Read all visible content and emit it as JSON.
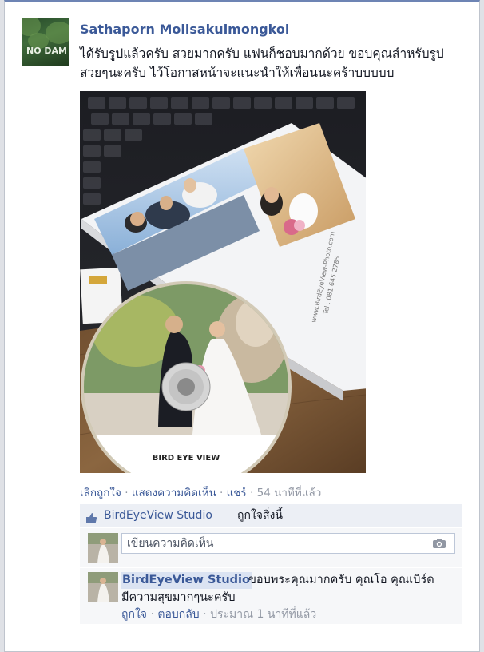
{
  "post": {
    "author": "Sathaporn Molisakulmongkol",
    "avatar_text": "NO DAM",
    "text": "ได้รับรูปแล้วครับ สวยมากครับ แฟนก็ชอบมากด้วย ขอบคุณสำหรับรูปสวยๆนะครับ ไว้โอกาสหน้าจะแนะนำให้เพื่อนนะคร้าบบบบบ",
    "photo": {
      "album_contact": "www.BirdEyeView-Photo.com",
      "album_phone": "Tel : 081 645 2785",
      "disc_brand": "BIRD EYE VIEW"
    }
  },
  "actions": {
    "unlike": "เลิกถูกใจ",
    "comment": "แสดงความคิดเห็น",
    "share": "แชร์",
    "separator": "·",
    "time": "54 นาทีที่แล้ว"
  },
  "likes": {
    "icon": "thumbs-up-icon",
    "who": "BirdEyeView Studio",
    "rest": "ถูกใจสิ่งนี้"
  },
  "comment_box": {
    "placeholder": "เขียนความคิดเห็น",
    "icon": "camera-icon"
  },
  "reply": {
    "author": "BirdEyeView Studio",
    "text_line1": "ขอบพระคุณมากครับ คุณโอ คุณเบิร์ด",
    "text_line2": "มีความสุขมากๆนะครับ",
    "like": "ถูกใจ",
    "reply": "ตอบกลับ",
    "separator": "·",
    "time": "ประมาณ 1 นาทีที่แล้ว"
  },
  "colors": {
    "link": "#3b5998",
    "meta": "#9197a3",
    "likebar_bg": "#eceff5",
    "comment_bg": "#f6f7f9"
  }
}
